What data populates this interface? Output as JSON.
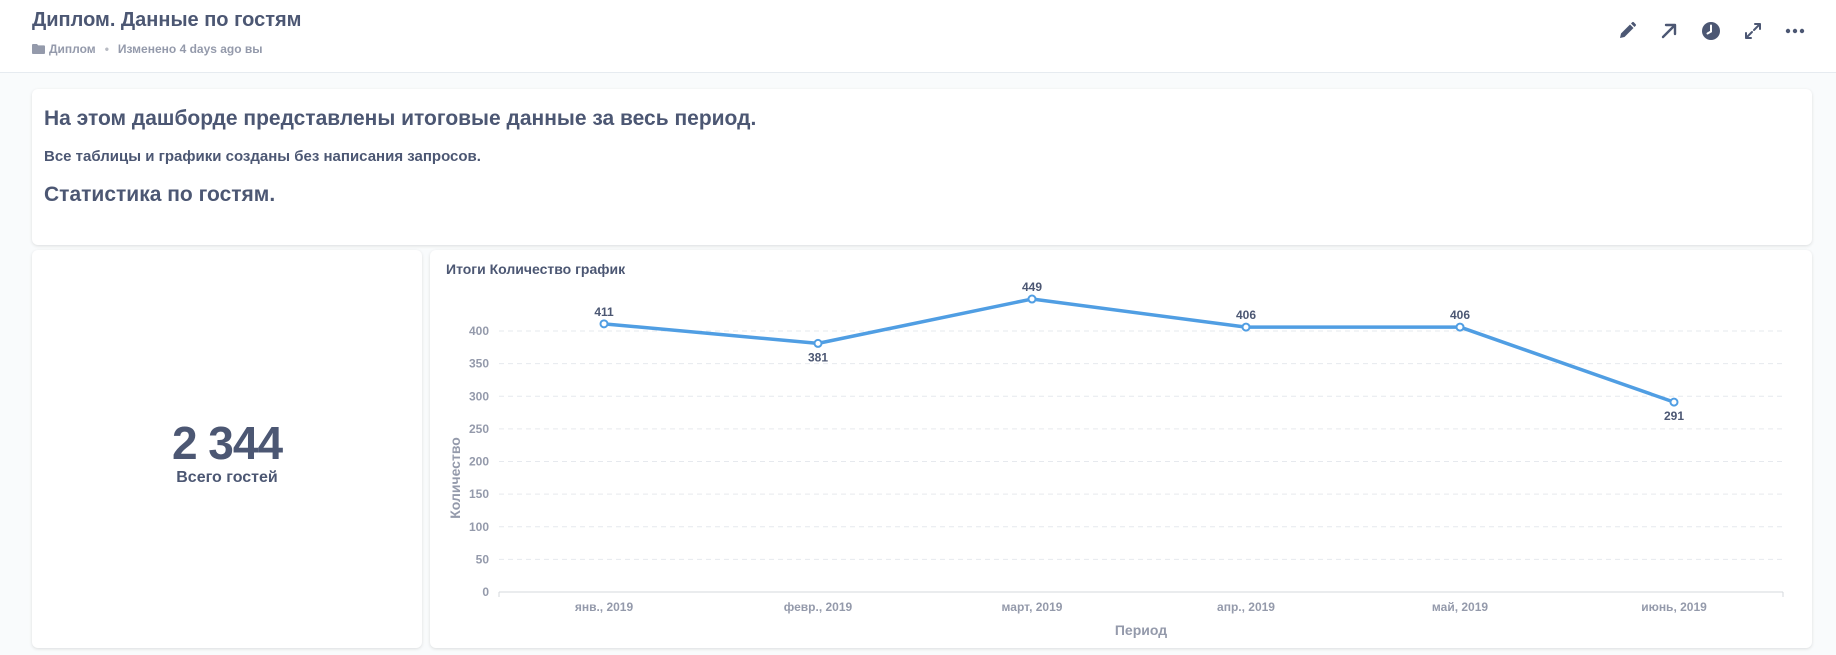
{
  "header": {
    "title": "Диплом. Данные по гостям",
    "collection": "Диплом",
    "modified": "Изменено 4 days ago вы"
  },
  "toolbar": {
    "icons": [
      "pencil-icon",
      "arrow-up-right-icon",
      "clock-icon",
      "expand-icon",
      "more-icon"
    ]
  },
  "text_card": {
    "heading": "На этом дашборде представлены итоговые данные за весь период.",
    "paragraph": "Все таблицы и графики созданы без написания запросов.",
    "subheading": "Статистика по гостям."
  },
  "scalar": {
    "value": "2 344",
    "label": "Всего гостей"
  },
  "chart": {
    "title": "Итоги Количество график"
  },
  "colors": {
    "accent": "#509ee3",
    "text": "#4c5773",
    "muted": "#949aab"
  },
  "chart_data": {
    "type": "line",
    "title": "Итоги Количество график",
    "xlabel": "Период",
    "ylabel": "Количество",
    "categories": [
      "янв., 2019",
      "февр., 2019",
      "март, 2019",
      "апр., 2019",
      "май, 2019",
      "июнь, 2019"
    ],
    "values": [
      411,
      381,
      449,
      406,
      406,
      291
    ],
    "ylim": [
      0,
      400
    ],
    "yticks": [
      0,
      50,
      100,
      150,
      200,
      250,
      300,
      350,
      400
    ],
    "grid": true,
    "color": "#509ee3"
  }
}
